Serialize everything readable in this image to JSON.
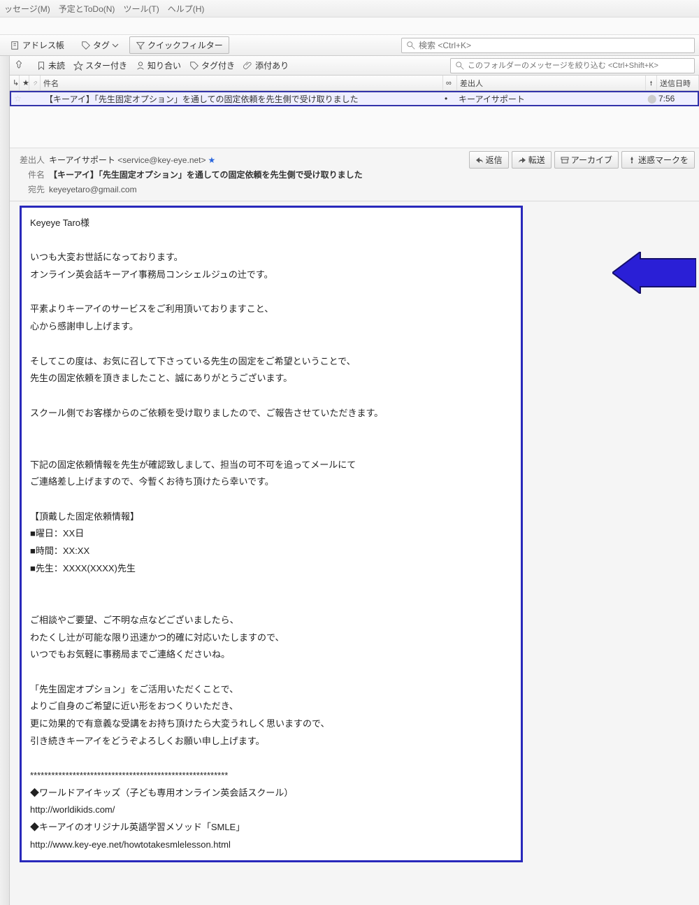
{
  "menu": {
    "message": "ッセージ(M)",
    "todo": "予定とToDo(N)",
    "tools": "ツール(T)",
    "help": "ヘルプ(H)"
  },
  "toolbar": {
    "addressbook": "アドレス帳",
    "tag": "タグ",
    "quickfilter": "クイックフィルター",
    "search_placeholder": "検索 <Ctrl+K>"
  },
  "filters": {
    "unread": "未読",
    "starred": "スター付き",
    "contact": "知り合い",
    "tagged": "タグ付き",
    "attach": "添付あり",
    "folder_search_placeholder": "このフォルダーのメッセージを絞り込む <Ctrl+Shift+K>"
  },
  "columns": {
    "subject": "件名",
    "sender": "差出人",
    "time": "送信日時"
  },
  "row": {
    "subject": "【キーアイ】「先生固定オプション」を通しての固定依頼を先生側で受け取りました",
    "sender": "キーアイサポート",
    "time": "7:56"
  },
  "actions": {
    "reply": "返信",
    "forward": "転送",
    "archive": "アーカイブ",
    "spam": "迷惑マークを"
  },
  "header": {
    "from_label": "差出人",
    "from_name": "キーアイサポート",
    "from_addr": "<service@key-eye.net>",
    "subj_label": "件名",
    "subj": "【キーアイ】「先生固定オプション」を通しての固定依頼を先生側で受け取りました",
    "to_label": "宛先",
    "to": "keyeyetaro@gmail.com"
  },
  "body": {
    "l1": "Keyeye Taro様",
    "l2": "いつも大変お世話になっております。",
    "l3": "オンライン英会話キーアイ事務局コンシェルジュの辻です。",
    "l4": "平素よりキーアイのサービスをご利用頂いておりますこと、",
    "l5": "心から感謝申し上げます。",
    "l6": "そしてこの度は、お気に召して下さっている先生の固定をご希望ということで、",
    "l7": "先生の固定依頼を頂きましたこと、誠にありがとうございます。",
    "l8": "スクール側でお客様からのご依頼を受け取りましたので、ご報告させていただきます。",
    "l9": "下記の固定依頼情報を先生が確認致しまして、担当の可不可を追ってメールにて",
    "l10": "ご連絡差し上げますので、今暫くお待ち頂けたら幸いです。",
    "l11": "【頂戴した固定依頼情報】",
    "l12": "■曜日：XX日",
    "l13": "■時間：XX:XX",
    "l14": "■先生：XXXX(XXXX)先生",
    "l15": "ご相談やご要望、ご不明な点などございましたら、",
    "l16": "わたくし辻が可能な限り迅速かつ的確に対応いたしますので、",
    "l17": "いつでもお気軽に事務局までご連絡くださいね。",
    "l18": "「先生固定オプション」をご活用いただくことで、",
    "l19": "よりご自身のご希望に近い形をおつくりいただき、",
    "l20": "更に効果的で有意義な受講をお持ち頂けたら大変うれしく思いますので、",
    "l21": "引き続きキーアイをどうぞよろしくお願い申し上げます。",
    "l22": "********************************************************",
    "l23": "◆ワールドアイキッズ（子ども専用オンライン英会話スクール）",
    "l24": "http://worldikids.com/",
    "l25": "◆キーアイのオリジナル英語学習メソッド「SMLE」",
    "l26": "http://www.key-eye.net/howtotakesmlelesson.html"
  }
}
